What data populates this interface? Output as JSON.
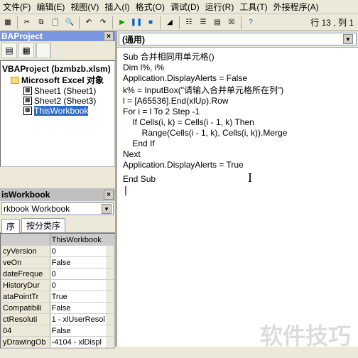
{
  "menu": {
    "file": "文件(F)",
    "edit": "编辑(E)",
    "view": "视图(V)",
    "insert": "插入(I)",
    "format": "格式(O)",
    "debug": "调试(D)",
    "run": "运行(R)",
    "tools": "工具(T)",
    "addins": "外接程序(A)"
  },
  "status": {
    "line_col": "行 13 , 列 1"
  },
  "project_explorer": {
    "title": "BAProject",
    "root": "VBAProject (bzmbzb.xlsm)",
    "folder": "Microsoft Excel 对象",
    "sheet1": "Sheet1 (Sheet1)",
    "sheet2": "Sheet2 (Sheet3)",
    "thiswb": "ThisWorkbook"
  },
  "properties": {
    "title": "isWorkbook",
    "combo": "rkbook Workbook",
    "tab_alpha": "序",
    "tab_cat": "按分类序",
    "rows": [
      {
        "k": "",
        "v": "ThisWorkbook"
      },
      {
        "k": "cyVersion",
        "v": "0"
      },
      {
        "k": "veOn",
        "v": "False"
      },
      {
        "k": "dateFreque",
        "v": "0"
      },
      {
        "k": "HistoryDur",
        "v": "0"
      },
      {
        "k": "ataPointTr",
        "v": "True"
      },
      {
        "k": "Compatibili",
        "v": "False"
      },
      {
        "k": "ctResoluti",
        "v": "1 - xlUserResol"
      },
      {
        "k": "04",
        "v": "False"
      },
      {
        "k": "yDrawingOb",
        "v": "-4104 - xlDispl"
      }
    ]
  },
  "module": {
    "combo": "(通用)"
  },
  "code_lines": [
    "Sub 合并相同用单元格()",
    "Dim l%, i%",
    "Application.DisplayAlerts = False",
    "k% = InputBox(\"请输入合并单元格所在列\")",
    "l = [A65536].End(xlUp).Row",
    "For i = l To 2 Step -1",
    "    If Cells(i, k) = Cells(i - 1, k) Then",
    "        Range(Cells(i - 1, k), Cells(i, k)).Merge",
    "    End If",
    "Next",
    "Application.DisplayAlerts = True",
    "End Sub"
  ],
  "watermark": "软件技巧"
}
